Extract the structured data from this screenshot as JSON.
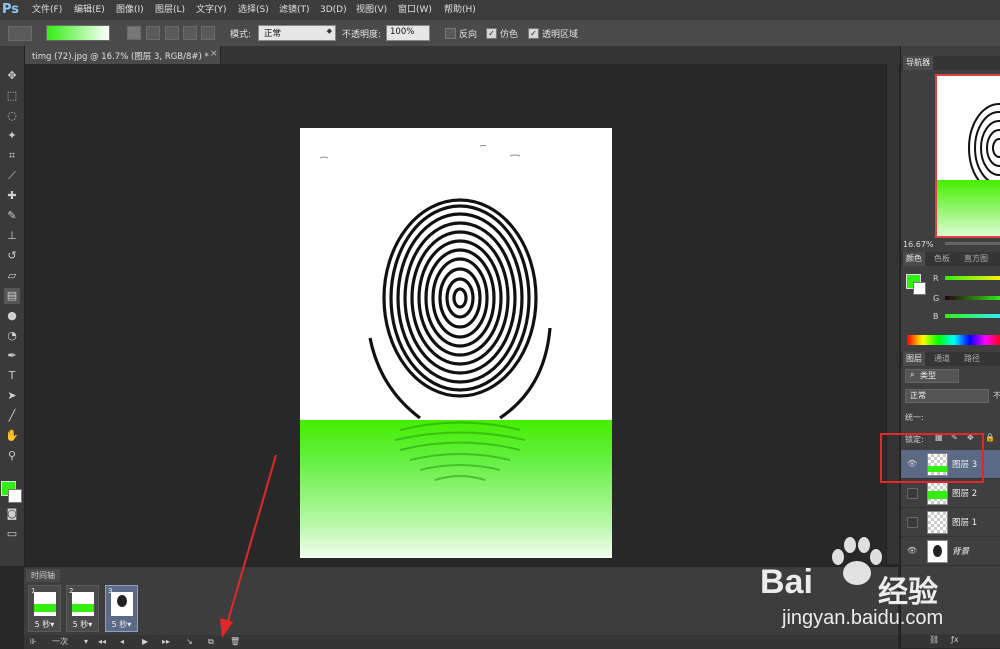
{
  "app": {
    "logo": "Ps"
  },
  "menu": [
    "文件(F)",
    "编辑(E)",
    "图像(I)",
    "图层(L)",
    "文字(Y)",
    "选择(S)",
    "滤镜(T)",
    "3D(D)",
    "视图(V)",
    "窗口(W)",
    "帮助(H)"
  ],
  "options": {
    "mode_label": "模式:",
    "mode_value": "正常",
    "opacity_label": "不透明度:",
    "opacity_value": "100%",
    "reverse_label": "反向",
    "dither_label": "仿色",
    "transparency_label": "透明区域"
  },
  "document": {
    "tab_title": "timg (72).jpg @ 16.7% (图层 3, RGB/8#) *",
    "tab_close": "×"
  },
  "timeline": {
    "tab_label": "时间轴",
    "frames": [
      {
        "num": "1",
        "time": "5 秒▾"
      },
      {
        "num": "2",
        "time": "5 秒▾"
      },
      {
        "num": "3",
        "time": "5 秒▾"
      }
    ],
    "loop_label": "一次"
  },
  "navigator": {
    "tab_label": "导航器",
    "zoom": "16.67%"
  },
  "color_panel": {
    "tabs": [
      "颜色",
      "色板",
      "直方图"
    ],
    "channels": [
      "R",
      "G",
      "B"
    ]
  },
  "layers_panel": {
    "tabs": [
      "图层",
      "通道",
      "路径"
    ],
    "kind_label": "类型",
    "blend_mode": "正常",
    "opacity_short": "不",
    "unify_label": "统一:",
    "lock_label": "锁定:",
    "layers": [
      {
        "name": "图层 3",
        "visible": true,
        "selected": true
      },
      {
        "name": "图层 2",
        "visible": false,
        "selected": false
      },
      {
        "name": "图层 1",
        "visible": false,
        "selected": false
      },
      {
        "name": "背景",
        "visible": true,
        "selected": false
      }
    ]
  },
  "watermark": {
    "brand": "Bai",
    "brand_cn": "经验",
    "url": "jingyan.baidu.com"
  },
  "colors": {
    "foreground": "#33ee11",
    "background": "#ffffff",
    "highlight": "#e02828"
  }
}
